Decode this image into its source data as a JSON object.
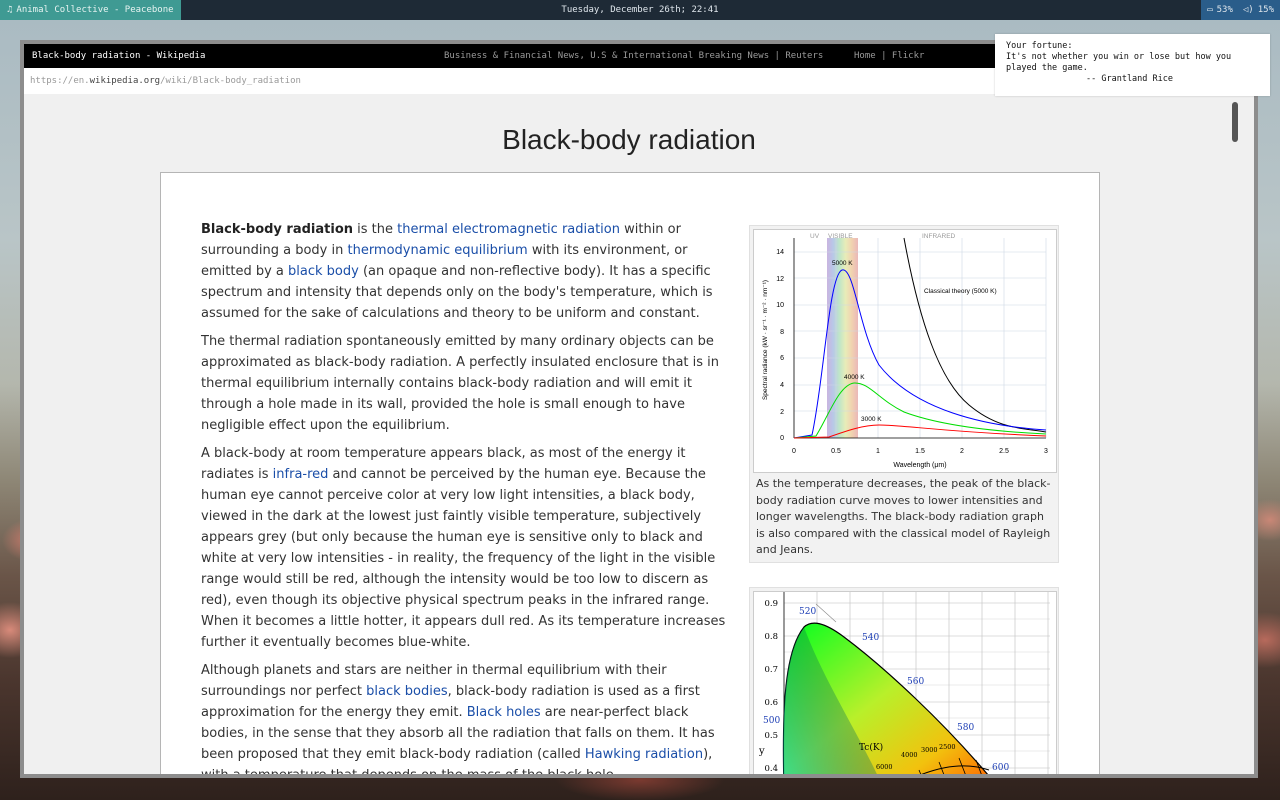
{
  "topbar": {
    "now_playing": "Animal Collective - Peacebone",
    "datetime": "Tuesday, December 26th; 22:41",
    "battery": "53%",
    "volume": "15%"
  },
  "browser": {
    "active_tab": "Black-body radiation - Wikipedia",
    "other_tabs": "Business & Financial News, U.S & International Breaking News | Reuters",
    "right_tabs": "Home | Flickr",
    "url_prefix": "https://en.",
    "url_domain": "wikipedia.org",
    "url_path": "/wiki/Black-body_radiation"
  },
  "article": {
    "title": "Black-body radiation",
    "p1": {
      "lead": "Black-body radiation",
      "t1": " is the ",
      "l1": "thermal electromagnetic radiation",
      "t2": " within or surrounding a body in ",
      "l2": "thermodynamic equilibrium",
      "t3": " with its environment, or emitted by a ",
      "l3": "black body",
      "t4": " (an opaque and non-reflective body). It has a specific spectrum and intensity that depends only on the body's temperature, which is assumed for the sake of calculations and theory to be uniform and constant."
    },
    "p2": "The thermal radiation spontaneously emitted by many ordinary objects can be approximated as black-body radiation. A perfectly insulated enclosure that is in thermal equilibrium internally contains black-body radiation and will emit it through a hole made in its wall, provided the hole is small enough to have negligible effect upon the equilibrium.",
    "p3": {
      "t1": "A black-body at room temperature appears black, as most of the energy it radiates is ",
      "l1": "infra-red",
      "t2": " and cannot be perceived by the human eye. Because the human eye cannot perceive color at very low light intensities, a black body, viewed in the dark at the lowest just faintly visible temperature, subjectively appears grey (but only because the human eye is sensitive only to black and white at very low intensities - in reality, the frequency of the light in the visible range would still be red, although the intensity would be too low to discern as red), even though its objective physical spectrum peaks in the infrared range. When it becomes a little hotter, it appears dull red. As its temperature increases further it eventually becomes blue-white."
    },
    "p4": {
      "t1": "Although planets and stars are neither in thermal equilibrium with their surroundings nor perfect ",
      "l1": "black bodies",
      "t2": ", black-body radiation is used as a first approximation for the energy they emit. ",
      "l2": "Black holes",
      "t3": " are near-perfect black bodies, in the sense that they absorb all the radiation that falls on them. It has been proposed that they emit black-body radiation (called ",
      "l3": "Hawking radiation",
      "t4": "), with a temperature that depends on the mass of the black hole."
    },
    "figure1_caption": "As the temperature decreases, the peak of the black-body radiation curve moves to lower intensities and longer wavelengths. The black-body radiation graph is also compared with the classical model of Rayleigh and Jeans."
  },
  "figure1": {
    "band_labels": [
      "UV",
      "VISIBLE",
      "INFRARED"
    ],
    "y_ticks": [
      "14",
      "12",
      "10",
      "8",
      "6",
      "4",
      "2",
      "0"
    ],
    "x_ticks": [
      "0",
      "0.5",
      "1",
      "1.5",
      "2",
      "2.5",
      "3"
    ],
    "ylabel": "Spectral radiance (kW · sr⁻¹ · m⁻² · nm⁻¹)",
    "xlabel": "Wavelength (μm)",
    "series": [
      {
        "name": "5000 K",
        "color": "#0000ff"
      },
      {
        "name": "4000 K",
        "color": "#00dd00"
      },
      {
        "name": "3000 K",
        "color": "#ff0000"
      },
      {
        "name": "Classical theory (5000 K)",
        "color": "#000000"
      }
    ]
  },
  "figure2": {
    "y_ticks": [
      "0.9",
      "0.8",
      "0.7",
      "0.6",
      "0.5",
      "0.4"
    ],
    "ylabel": "y",
    "wavelength_labels": [
      "520",
      "540",
      "560",
      "580",
      "600",
      "500"
    ],
    "tc_label": "Tc(K)",
    "temp_labels": [
      "4000",
      "3000",
      "2500",
      "6000"
    ]
  },
  "fortune": {
    "heading": "Your fortune:",
    "quote": "It's not whether you win or lose but how you played the game.",
    "author": "-- Grantland Rice"
  }
}
